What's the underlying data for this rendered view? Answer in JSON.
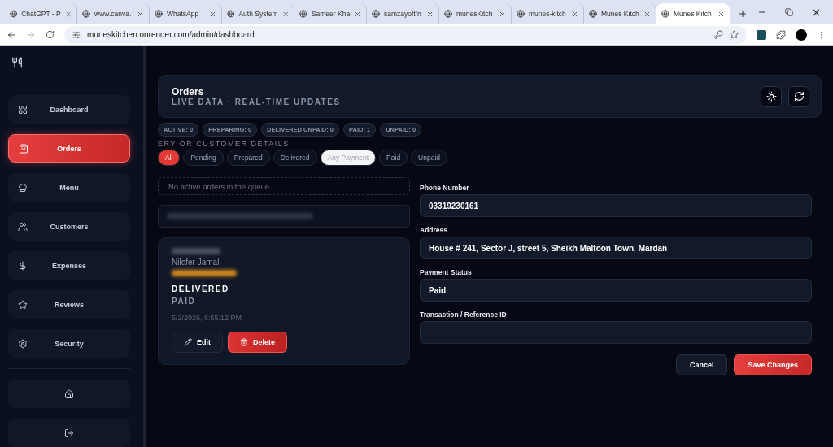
{
  "browser": {
    "tabs": [
      {
        "title": "ChatGPT - P",
        "selected": false
      },
      {
        "title": "www.canva.",
        "selected": false
      },
      {
        "title": "WhatsApp",
        "selected": false
      },
      {
        "title": "Auth System",
        "selected": false
      },
      {
        "title": "Sameer Kha",
        "selected": false
      },
      {
        "title": "samzayoff/n",
        "selected": false
      },
      {
        "title": "munesKitch",
        "selected": false
      },
      {
        "title": "munes-kitch",
        "selected": false
      },
      {
        "title": "Munes Kitch",
        "selected": false
      },
      {
        "title": "Munes Kitch",
        "selected": true
      }
    ],
    "address": "muneskitchen.onrender.com/admin/dashboard"
  },
  "sidebar": {
    "items": [
      {
        "label": "Dashboard",
        "selected": false
      },
      {
        "label": "Orders",
        "selected": true
      },
      {
        "label": "Menu",
        "selected": false
      },
      {
        "label": "Customers",
        "selected": false
      },
      {
        "label": "Expenses",
        "selected": false
      },
      {
        "label": "Reviews",
        "selected": false
      },
      {
        "label": "Security",
        "selected": false
      }
    ]
  },
  "header": {
    "title": "Orders",
    "subtitle": "LIVE DATA · REAL-TIME UPDATES"
  },
  "stats": [
    "ACTIVE: 0",
    "PREPARING: 0",
    "DELIVERED UNPAID: 0",
    "PAID: 1",
    "UNPAID: 0"
  ],
  "section_text": "ERY OR CUSTOMER DETAILS",
  "filters": [
    {
      "label": "All",
      "kind": "status",
      "selected": true
    },
    {
      "label": "Pending",
      "kind": "status",
      "selected": false
    },
    {
      "label": "Prepared",
      "kind": "status",
      "selected": false
    },
    {
      "label": "Delivered",
      "kind": "status",
      "selected": false
    },
    {
      "label": "Any Payment",
      "kind": "payment",
      "selected": true
    },
    {
      "label": "Paid",
      "kind": "payment",
      "selected": false
    },
    {
      "label": "Unpaid",
      "kind": "payment",
      "selected": false
    }
  ],
  "empty_state": "No active orders in the queue.",
  "order": {
    "customer": "Nilofer Jamal",
    "status": "DELIVERED",
    "payment": "PAID",
    "time": "5/2/2026, 6:55:12 PM",
    "edit": "Edit",
    "delete": "Delete"
  },
  "form": {
    "fields": [
      {
        "label": "Phone Number",
        "value": "03319230161"
      },
      {
        "label": "Address",
        "value": "House # 241, Sector J, street 5, Sheikh Maltoon Town, Mardan"
      },
      {
        "label": "Payment Status",
        "value": "Paid"
      },
      {
        "label": "Transaction / Reference ID"
      }
    ],
    "cancel": "Cancel",
    "save": "Save Changes"
  }
}
